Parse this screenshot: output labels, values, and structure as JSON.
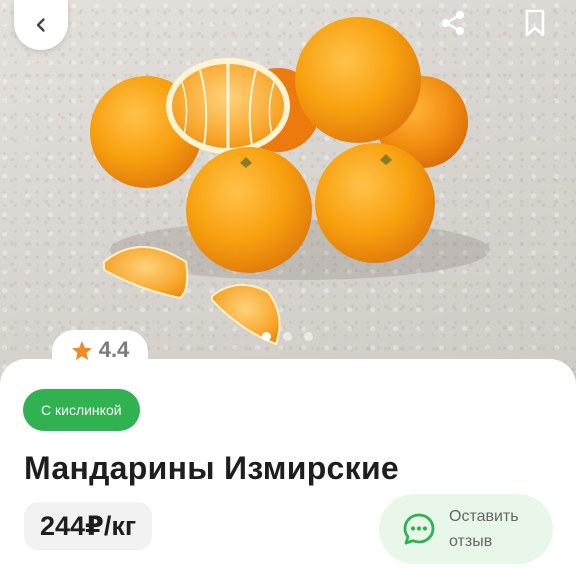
{
  "hero": {
    "image_name": "mandarins-photo",
    "slides_total": 3,
    "slide_active": 1
  },
  "top_bar": {
    "back_icon": "chevron-left-icon",
    "share_icon": "share-icon",
    "bookmark_icon": "bookmark-icon"
  },
  "rating": {
    "value": "4.4",
    "icon": "star-icon",
    "color": "#f08a24"
  },
  "product": {
    "tag": "С кислинкой",
    "title": "Мандарины Измирские",
    "price": "244₽/кг"
  },
  "review_button": {
    "label": "Оставить\nотзыв",
    "icon": "chat-bubble-icon"
  },
  "colors": {
    "accent_green": "#2fb24f",
    "review_bg": "#e9f6ea",
    "orange": "#f59a12"
  }
}
